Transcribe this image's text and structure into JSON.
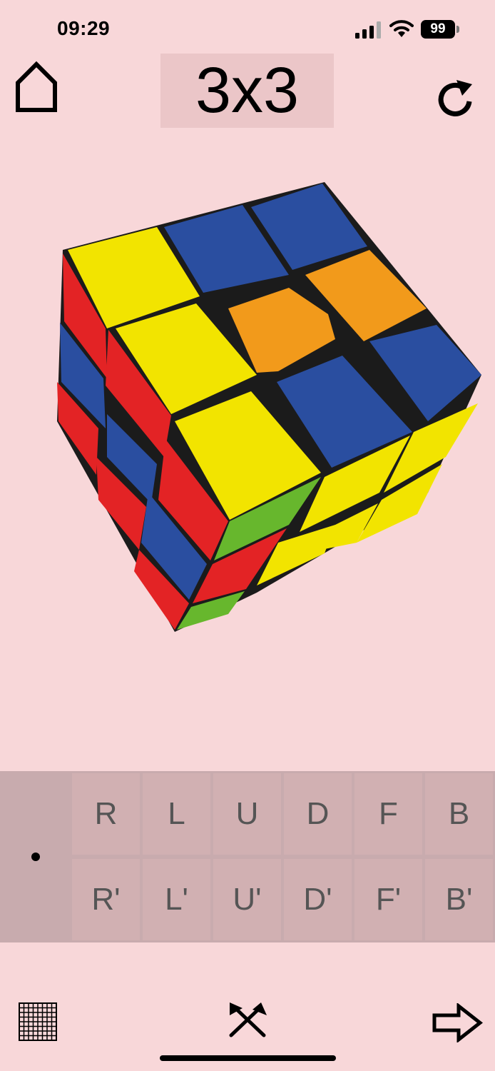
{
  "status_bar": {
    "time": "09:29",
    "battery": "99"
  },
  "header": {
    "title": "3x3"
  },
  "moves": {
    "row1": [
      "R",
      "L",
      "U",
      "D",
      "F",
      "B"
    ],
    "row2": [
      "R'",
      "L'",
      "U'",
      "D'",
      "F'",
      "B'"
    ],
    "toggle_glyph": "•"
  },
  "cube_colors": {
    "yellow": "#f2e400",
    "blue": "#2a4ea0",
    "orange": "#f29a1b",
    "red": "#e32325",
    "green": "#67b72d",
    "body": "#1b1b1b"
  },
  "icons": {
    "home": "home-icon",
    "reset": "rotate-icon",
    "grid": "grid-icon",
    "scramble": "crossed-arrows-icon",
    "next": "arrow-right-icon"
  }
}
